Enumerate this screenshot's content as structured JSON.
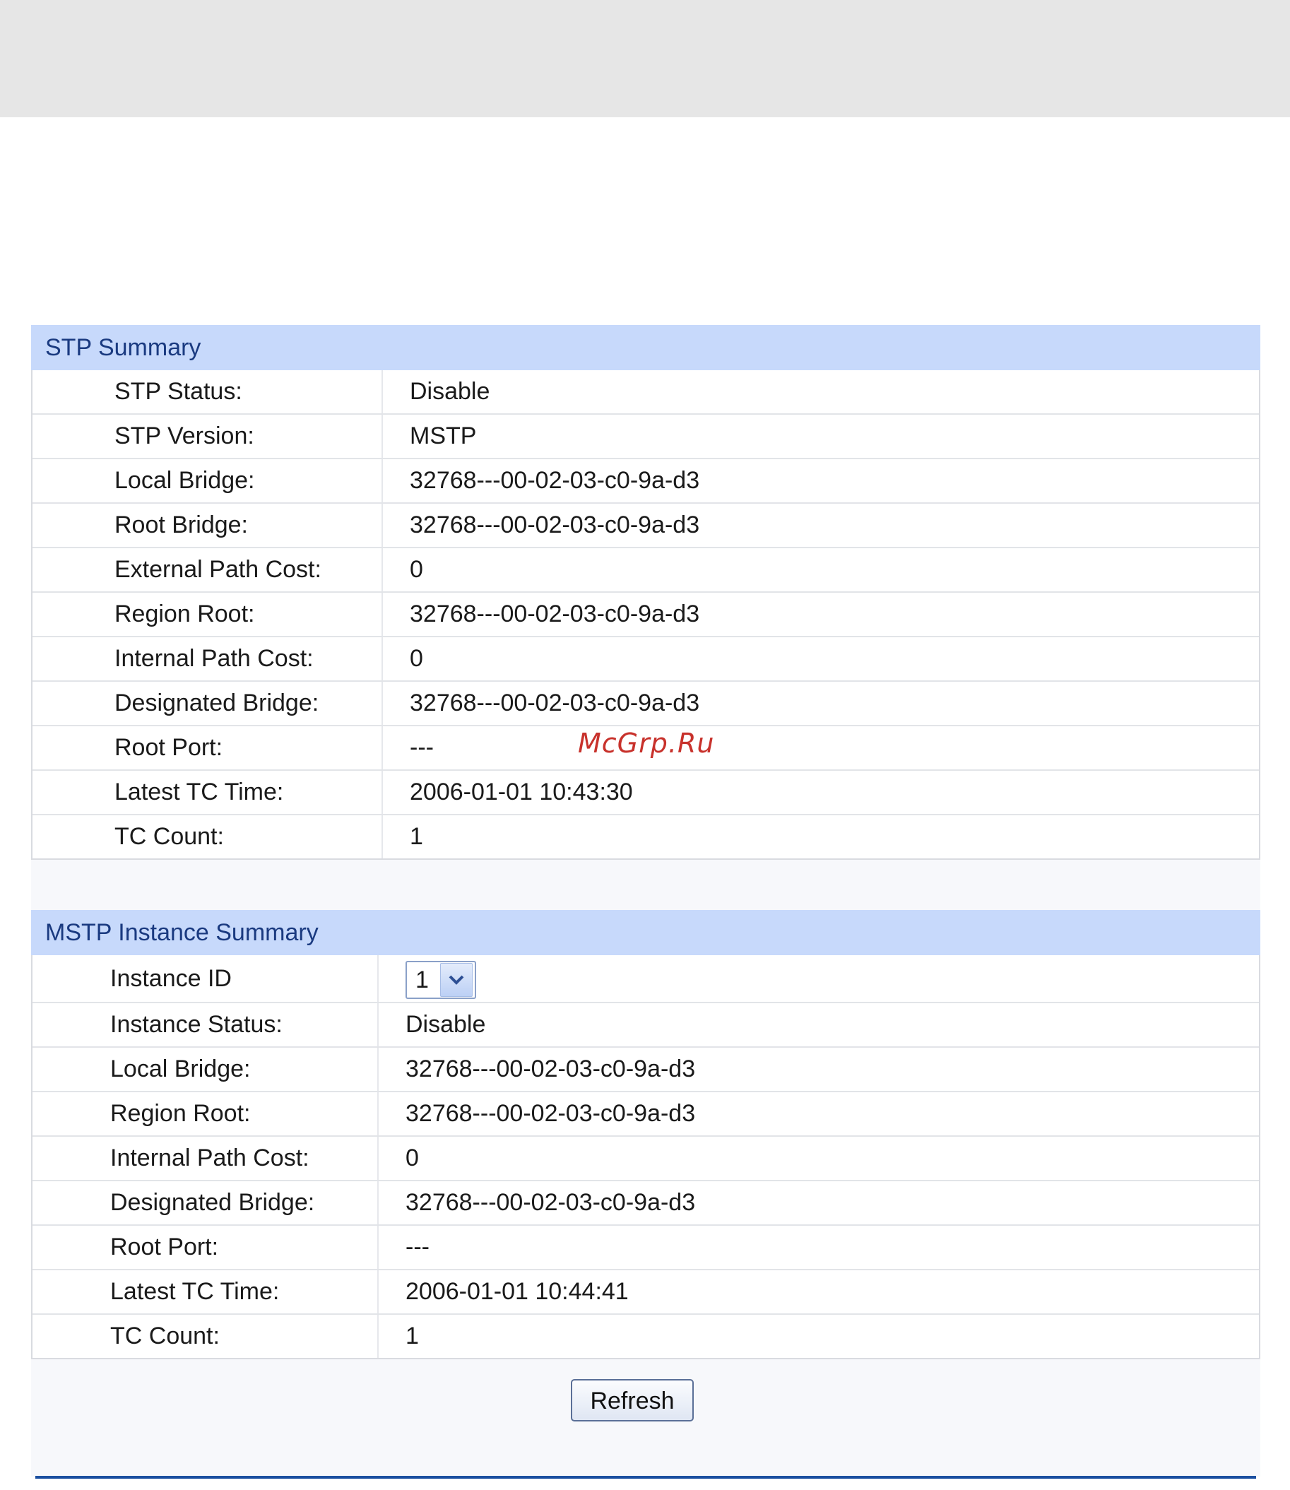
{
  "stp_summary": {
    "header": "STP Summary",
    "rows": [
      {
        "label": "STP Status:",
        "value": "Disable"
      },
      {
        "label": "STP Version:",
        "value": "MSTP"
      },
      {
        "label": "Local Bridge:",
        "value": "32768---00-02-03-c0-9a-d3"
      },
      {
        "label": "Root Bridge:",
        "value": "32768---00-02-03-c0-9a-d3"
      },
      {
        "label": "External Path Cost:",
        "value": "0"
      },
      {
        "label": "Region Root:",
        "value": "32768---00-02-03-c0-9a-d3"
      },
      {
        "label": "Internal Path Cost:",
        "value": "0"
      },
      {
        "label": "Designated Bridge:",
        "value": "32768---00-02-03-c0-9a-d3"
      },
      {
        "label": "Root Port:",
        "value": "---"
      },
      {
        "label": "Latest TC Time:",
        "value": "2006-01-01 10:43:30"
      },
      {
        "label": "TC Count:",
        "value": "1"
      }
    ]
  },
  "mstp_summary": {
    "header": "MSTP Instance Summary",
    "instance_id": {
      "label": "Instance ID",
      "selected": "1"
    },
    "rows": [
      {
        "label": "Instance Status:",
        "value": "Disable"
      },
      {
        "label": "Local Bridge:",
        "value": "32768---00-02-03-c0-9a-d3"
      },
      {
        "label": "Region Root:",
        "value": "32768---00-02-03-c0-9a-d3"
      },
      {
        "label": "Internal Path Cost:",
        "value": "0"
      },
      {
        "label": "Designated Bridge:",
        "value": "32768---00-02-03-c0-9a-d3"
      },
      {
        "label": "Root Port:",
        "value": "---"
      },
      {
        "label": "Latest TC Time:",
        "value": "2006-01-01 10:44:41"
      },
      {
        "label": "TC Count:",
        "value": "1"
      }
    ]
  },
  "refresh_label": "Refresh",
  "watermark": "McGrp.Ru",
  "icons": {
    "dropdown": "chevron-down-icon"
  },
  "colors": {
    "header_bg": "#c7d9fb",
    "header_text": "#1a3a80",
    "footer_line": "#1b4fa0",
    "watermark": "#c8322c"
  }
}
